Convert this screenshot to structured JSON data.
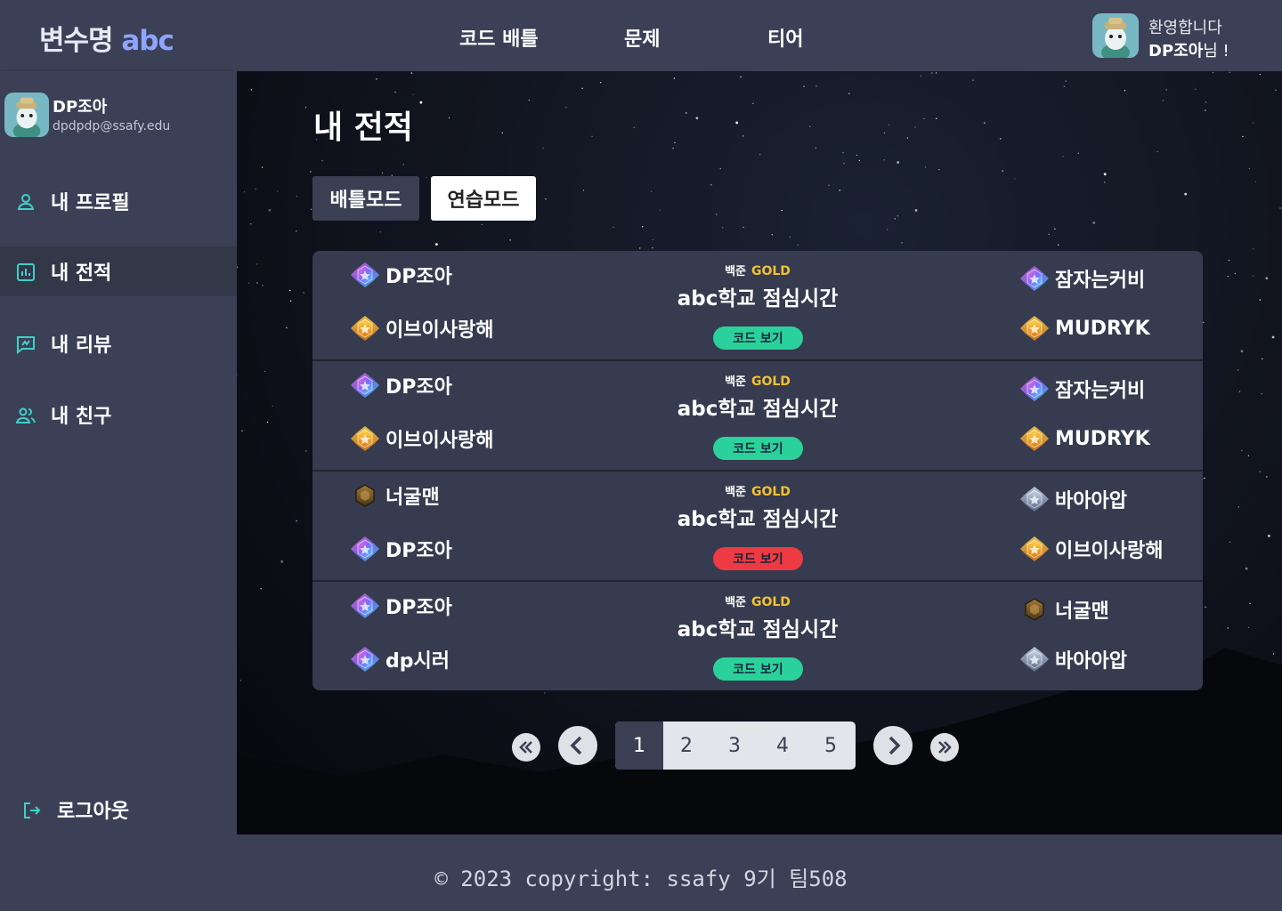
{
  "header": {
    "logo_main": "변수명",
    "logo_accent": "abc",
    "nav": [
      "코드 배틀",
      "문제",
      "티어"
    ],
    "welcome_line1": "환영합니다",
    "welcome_name": "DP조아",
    "welcome_suffix": "님 !"
  },
  "sidebar": {
    "user_name": "DP조아",
    "user_email": "dpdpdp@ssafy.edu",
    "items": [
      {
        "label": "내 프로필",
        "icon": "person-icon"
      },
      {
        "label": "내 전적",
        "icon": "chart-icon",
        "active": true
      },
      {
        "label": "내 리뷰",
        "icon": "review-icon"
      },
      {
        "label": "내 친구",
        "icon": "friends-icon"
      }
    ],
    "logout": "로그아웃"
  },
  "main": {
    "title": "내 전적",
    "tabs": [
      "배틀모드",
      "연습모드"
    ],
    "records": [
      {
        "left": [
          {
            "name": "DP조아",
            "tier": "diamond"
          },
          {
            "name": "이브이사랑해",
            "tier": "gold"
          }
        ],
        "right": [
          {
            "name": "잠자는커비",
            "tier": "diamond"
          },
          {
            "name": "MUDRYK",
            "tier": "gold"
          }
        ],
        "source": "백준",
        "level": "GOLD",
        "problem": "abc학교 점심시간",
        "code_label": "코드 보기",
        "result": "pass"
      },
      {
        "left": [
          {
            "name": "DP조아",
            "tier": "diamond"
          },
          {
            "name": "이브이사랑해",
            "tier": "gold"
          }
        ],
        "right": [
          {
            "name": "잠자는커비",
            "tier": "diamond"
          },
          {
            "name": "MUDRYK",
            "tier": "gold"
          }
        ],
        "source": "백준",
        "level": "GOLD",
        "problem": "abc학교 점심시간",
        "code_label": "코드 보기",
        "result": "pass"
      },
      {
        "left": [
          {
            "name": "너굴맨",
            "tier": "bronze"
          },
          {
            "name": "DP조아",
            "tier": "diamond"
          }
        ],
        "right": [
          {
            "name": "바아아압",
            "tier": "silver"
          },
          {
            "name": "이브이사랑해",
            "tier": "gold"
          }
        ],
        "source": "백준",
        "level": "GOLD",
        "problem": "abc학교 점심시간",
        "code_label": "코드 보기",
        "result": "fail"
      },
      {
        "left": [
          {
            "name": "DP조아",
            "tier": "diamond"
          },
          {
            "name": "dp시러",
            "tier": "diamond"
          }
        ],
        "right": [
          {
            "name": "너굴맨",
            "tier": "bronze"
          },
          {
            "name": "바아아압",
            "tier": "silver"
          }
        ],
        "source": "백준",
        "level": "GOLD",
        "problem": "abc학교 점심시간",
        "code_label": "코드 보기",
        "result": "pass"
      }
    ],
    "pagination": {
      "pages": [
        "1",
        "2",
        "3",
        "4",
        "5"
      ],
      "current": "1"
    }
  },
  "footer": {
    "copyright": "© 2023 copyright: ssafy 9기 팀508"
  },
  "colors": {
    "background": "#3b4056",
    "accent": "#8ea5ff",
    "pass": "#2bd19b",
    "fail": "#ee3a42",
    "gold_text": "#f2c230"
  }
}
